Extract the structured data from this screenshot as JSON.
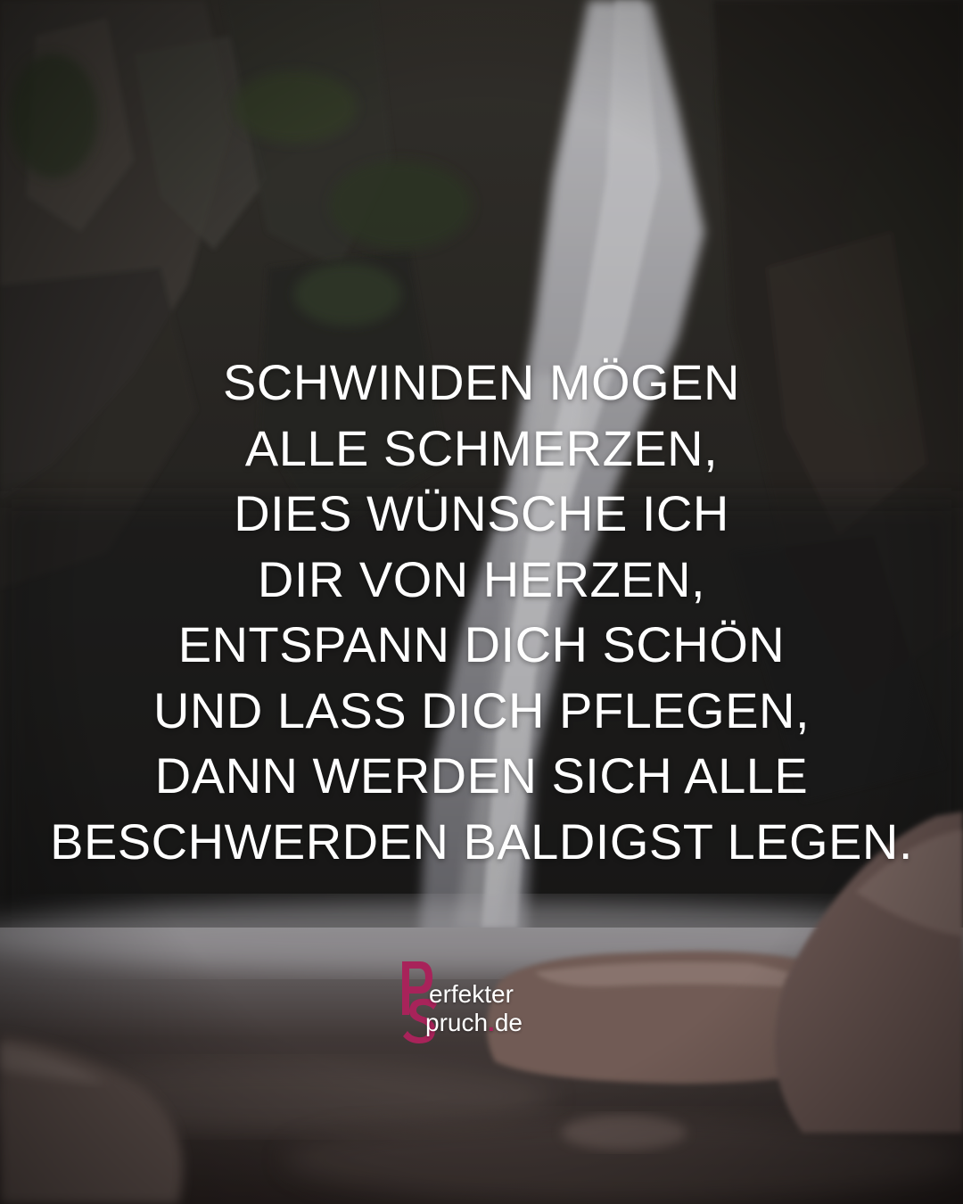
{
  "quote": {
    "lines": [
      "SCHWINDEN MÖGEN",
      "ALLE SCHMERZEN,",
      "DIES WÜNSCHE ICH",
      "DIR VON HERZEN,",
      "ENTSPANN DICH SCHÖN",
      "UND LASS DICH PFLEGEN,",
      "DANN WERDEN SICH ALLE",
      "BESCHWERDEN BALDIGST LEGEN."
    ]
  },
  "logo": {
    "line1": "erfekter",
    "line2_word": "pruch",
    "line2_dot": ".",
    "line2_tld": "de"
  },
  "colors": {
    "brand": "#a8235a",
    "text": "#ffffff"
  }
}
